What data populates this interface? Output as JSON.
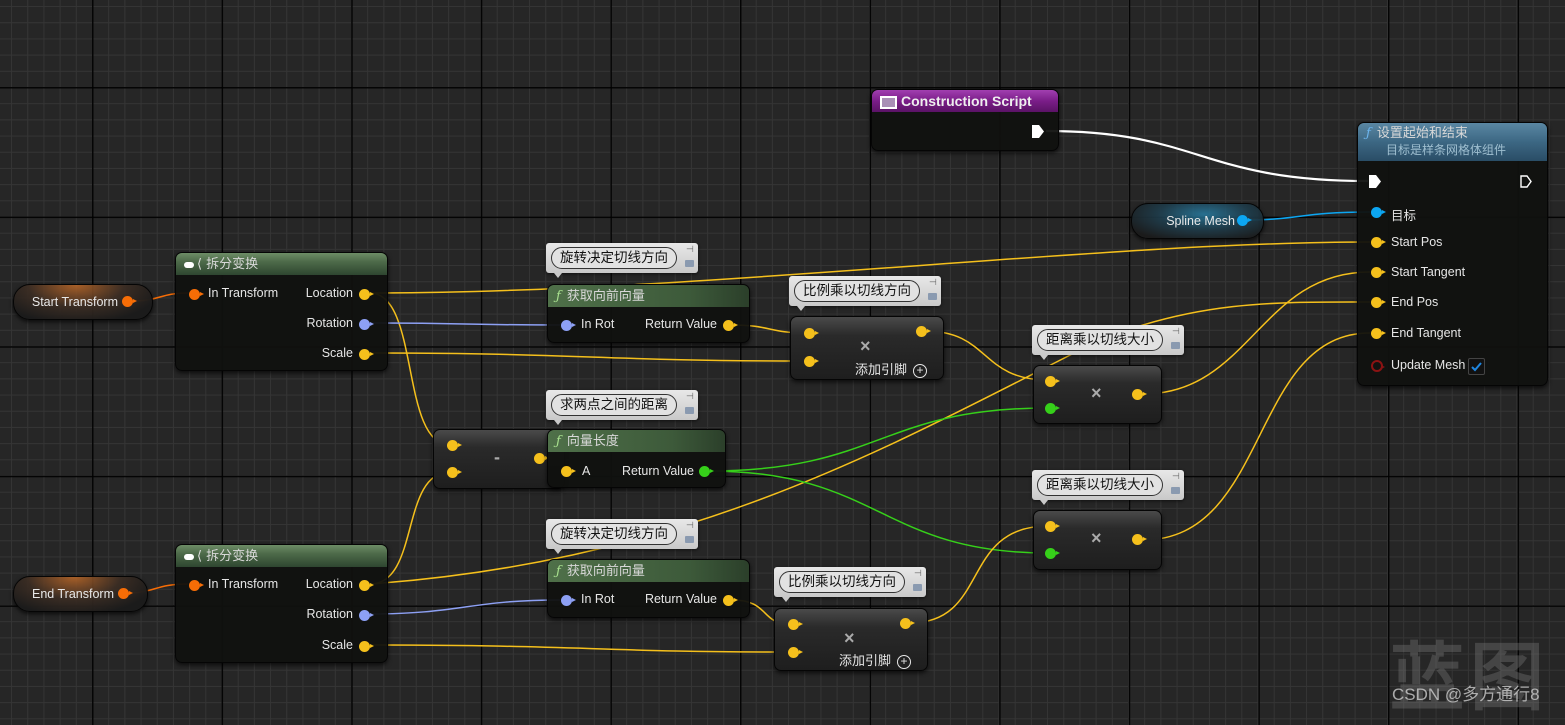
{
  "graph": {
    "colors": {
      "background": "#262626",
      "exec": "#ffffff",
      "vector": "#f5c01c",
      "rotator": "#8da0f4",
      "float": "#36d01a",
      "transform": "#f76d06",
      "object": "#0ca6f2",
      "bool": "#8b1313"
    }
  },
  "nodes": {
    "construction_script": {
      "title": "Construction Script",
      "icon": "event-icon"
    },
    "set_start_end": {
      "title": "设置起始和结束",
      "subtitle": "目标是样条网格体组件",
      "icon": "function-icon",
      "pins": {
        "target": "目标",
        "start_pos": "Start Pos",
        "start_tangent": "Start Tangent",
        "end_pos": "End Pos",
        "end_tangent": "End Tangent",
        "update_mesh": "Update Mesh"
      },
      "update_mesh_checked": true
    },
    "spline_mesh_var": {
      "label": "Spline Mesh"
    },
    "start_transform_var": {
      "label": "Start Transform"
    },
    "end_transform_var": {
      "label": "End Transform"
    },
    "break_transform_1": {
      "title": "拆分变换",
      "pins": {
        "in": "In Transform",
        "location": "Location",
        "rotation": "Rotation",
        "scale": "Scale"
      }
    },
    "break_transform_2": {
      "title": "拆分变换",
      "pins": {
        "in": "In Transform",
        "location": "Location",
        "rotation": "Rotation",
        "scale": "Scale"
      }
    },
    "get_forward_1": {
      "title": "获取向前向量",
      "pins": {
        "in": "In Rot",
        "out": "Return Value"
      },
      "comment": "旋转决定切线方向"
    },
    "get_forward_2": {
      "title": "获取向前向量",
      "pins": {
        "in": "In Rot",
        "out": "Return Value"
      },
      "comment": "旋转决定切线方向"
    },
    "multiply_1": {
      "symbol": "×",
      "add_pin": "添加引脚",
      "comment": "比例乘以切线方向"
    },
    "multiply_2": {
      "symbol": "×",
      "add_pin": "添加引脚",
      "comment": "比例乘以切线方向"
    },
    "subtract": {
      "symbol": "-"
    },
    "vector_length": {
      "title": "向量长度",
      "pins": {
        "in": "A",
        "out": "Return Value"
      },
      "comment": "求两点之间的距离"
    },
    "multiply_3": {
      "symbol": "×",
      "comment": "距离乘以切线大小"
    },
    "multiply_4": {
      "symbol": "×",
      "comment": "距离乘以切线大小"
    }
  },
  "watermark": {
    "big": "蓝图",
    "small": "CSDN @多方通行8"
  }
}
